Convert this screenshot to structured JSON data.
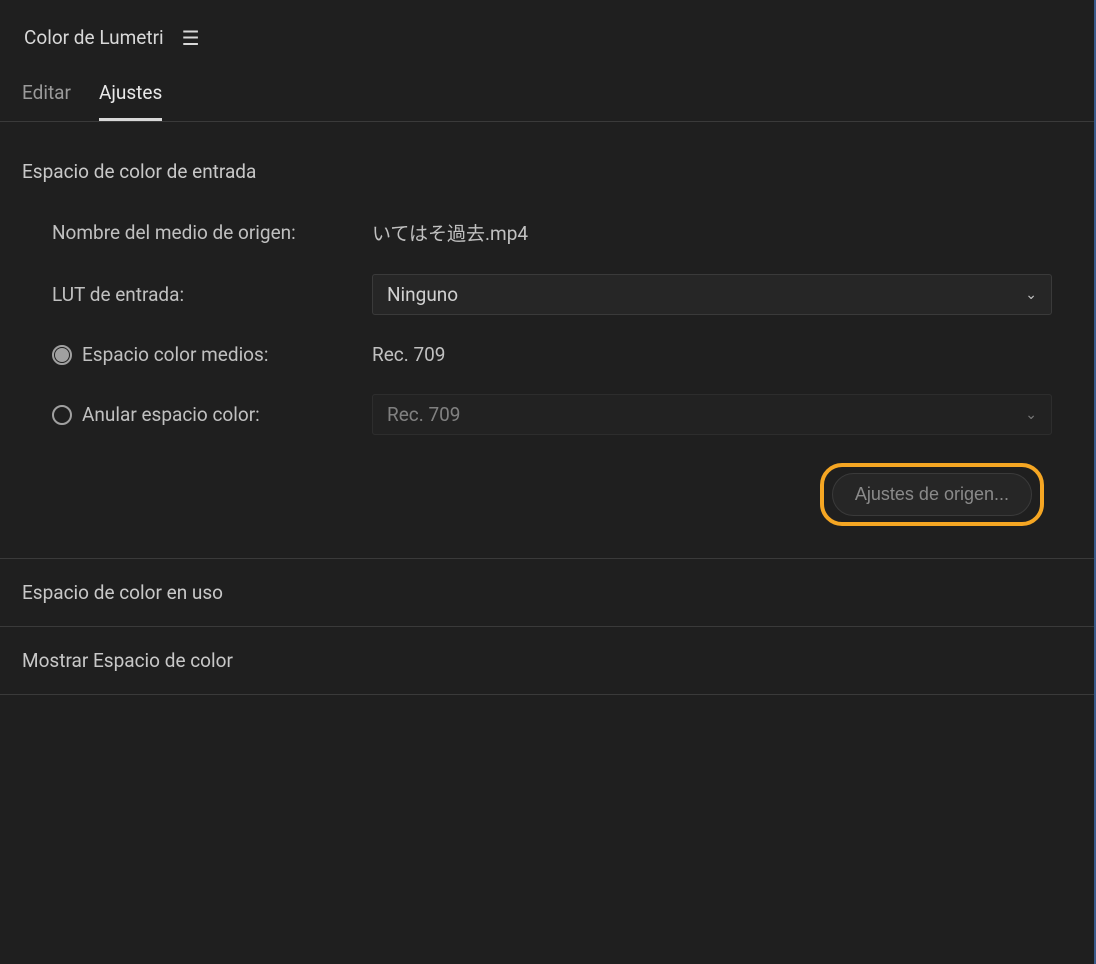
{
  "panel": {
    "title": "Color de Lumetri"
  },
  "tabs": {
    "edit": "Editar",
    "settings": "Ajustes"
  },
  "inputColorSpace": {
    "title": "Espacio de color de entrada",
    "sourceMediaLabel": "Nombre del medio de origen:",
    "sourceMediaValue": "いてはそ過去.mp4",
    "inputLutLabel": "LUT de entrada:",
    "inputLutValue": "Ninguno",
    "mediaColorSpaceLabel": "Espacio color medios:",
    "mediaColorSpaceValue": "Rec. 709",
    "overrideColorSpaceLabel": "Anular espacio color:",
    "overrideColorSpaceValue": "Rec. 709",
    "sourceSettingsButton": "Ajustes de origen..."
  },
  "workingColorSpace": {
    "title": "Espacio de color en uso"
  },
  "displayColorSpace": {
    "title": "Mostrar Espacio de color"
  }
}
